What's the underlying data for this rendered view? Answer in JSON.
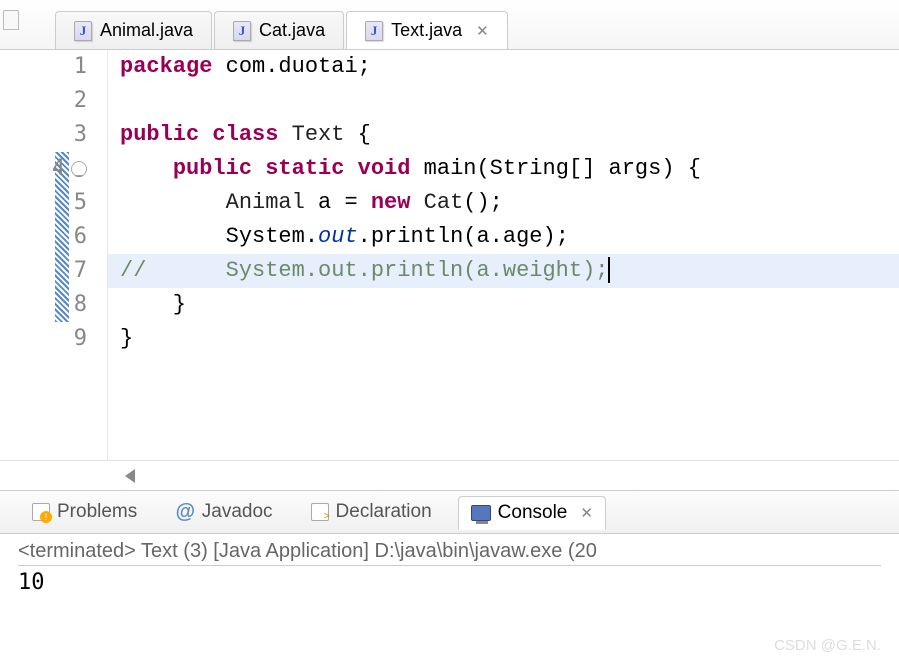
{
  "tabs": [
    {
      "label": "Animal.java",
      "active": false
    },
    {
      "label": "Cat.java",
      "active": false
    },
    {
      "label": "Text.java",
      "active": true
    }
  ],
  "gutter": {
    "lines": [
      "1",
      "2",
      "3",
      "4",
      "5",
      "6",
      "7",
      "8",
      "9"
    ]
  },
  "code": {
    "l1": {
      "kw1": "package",
      "rest": " com.duotai;"
    },
    "l2": "",
    "l3": {
      "kw1": "public",
      "kw2": "class",
      "cls": " Text",
      "brace": " {"
    },
    "l4": {
      "indent": "    ",
      "kw1": "public",
      "kw2": "static",
      "kw3": "void",
      "name": " main",
      "params": "(String[] args) {"
    },
    "l5": {
      "indent": "        ",
      "type1": "Animal",
      "var": " a = ",
      "kw": "new",
      "type2": " Cat",
      "rest": "();"
    },
    "l6": {
      "indent": "        ",
      "sys": "System.",
      "out": "out",
      "rest": ".println(a.age);"
    },
    "l7": "//      System.out.println(a.weight);",
    "l8": "    }",
    "l9": "}"
  },
  "bottom_tabs": {
    "problems": "Problems",
    "javadoc": "Javadoc",
    "declaration": "Declaration",
    "console": "Console",
    "javadoc_icon": "@"
  },
  "console": {
    "header": "<terminated> Text (3) [Java Application] D:\\java\\bin\\javaw.exe (20",
    "output": "10"
  },
  "watermark": "CSDN @G.E.N."
}
